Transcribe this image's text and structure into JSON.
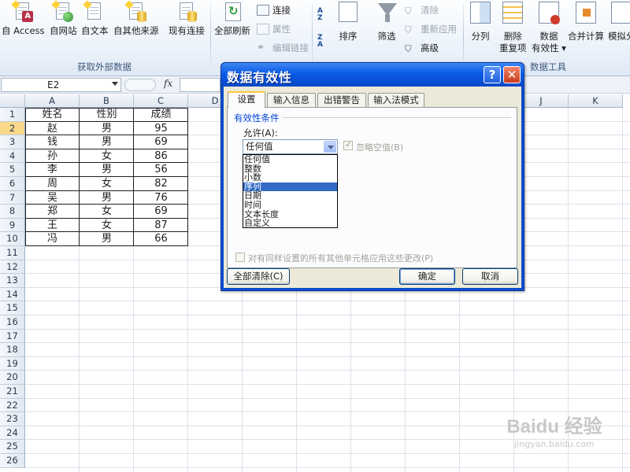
{
  "ribbon": {
    "get_external": {
      "access": "自 Access",
      "web": "自网站",
      "text": "自文本",
      "other": "自其他来源",
      "existing": "现有连接",
      "group_label": "获取外部数据"
    },
    "connections": {
      "refresh_all": "全部刷新",
      "connect": "连接",
      "properties": "属性",
      "edit_links": "编辑链接"
    },
    "sort_filter": {
      "sort": "排序",
      "filter": "筛选",
      "clear": "清除",
      "reapply": "重新应用",
      "advanced": "高级",
      "az_top": "A Z",
      "az_bottom": "Z A"
    },
    "data_tools": {
      "text_to_columns": "分列",
      "remove_dup_1": "删除",
      "remove_dup_2": "重复项",
      "validation_1": "数据",
      "validation_2": "有效性 ▾",
      "consolidate": "合并计算",
      "whatif": "模拟分",
      "group_label": "数据工具"
    }
  },
  "formula_bar": {
    "name_box": "E2",
    "fx": "fx"
  },
  "grid": {
    "columns": [
      "A",
      "B",
      "C",
      "D",
      "E",
      "F",
      "G",
      "H",
      "I",
      "J",
      "K"
    ],
    "rows": [
      "1",
      "2",
      "3",
      "4",
      "5",
      "6",
      "7",
      "8",
      "9",
      "10",
      "11",
      "12",
      "13",
      "14",
      "15",
      "16",
      "17",
      "18",
      "19",
      "20",
      "21",
      "22",
      "23",
      "24",
      "25",
      "26"
    ],
    "headers": [
      "姓名",
      "性别",
      "成绩"
    ],
    "data": [
      [
        "赵",
        "男",
        "95"
      ],
      [
        "钱",
        "男",
        "69"
      ],
      [
        "孙",
        "女",
        "86"
      ],
      [
        "李",
        "男",
        "56"
      ],
      [
        "周",
        "女",
        "82"
      ],
      [
        "吴",
        "男",
        "76"
      ],
      [
        "郑",
        "女",
        "69"
      ],
      [
        "王",
        "女",
        "87"
      ],
      [
        "冯",
        "男",
        "66"
      ]
    ]
  },
  "dialog": {
    "title": "数据有效性",
    "help": "?",
    "close": "✕",
    "tabs": [
      "设置",
      "输入信息",
      "出错警告",
      "输入法模式"
    ],
    "group_title": "有效性条件",
    "allow_label": "允许(A):",
    "allow_value": "任何值",
    "options": [
      "任何值",
      "整数",
      "小数",
      "序列",
      "日期",
      "时间",
      "文本长度",
      "自定义"
    ],
    "highlighted_option": "序列",
    "ignore_blank": "忽略空值(B)",
    "apply_all": "对有同样设置的所有其他单元格应用这些更改(P)",
    "clear_all": "全部清除(C)",
    "ok": "确定",
    "cancel": "取消"
  },
  "watermark": {
    "brand": "Baidu 经验",
    "url": "jingyan.baidu.com"
  }
}
